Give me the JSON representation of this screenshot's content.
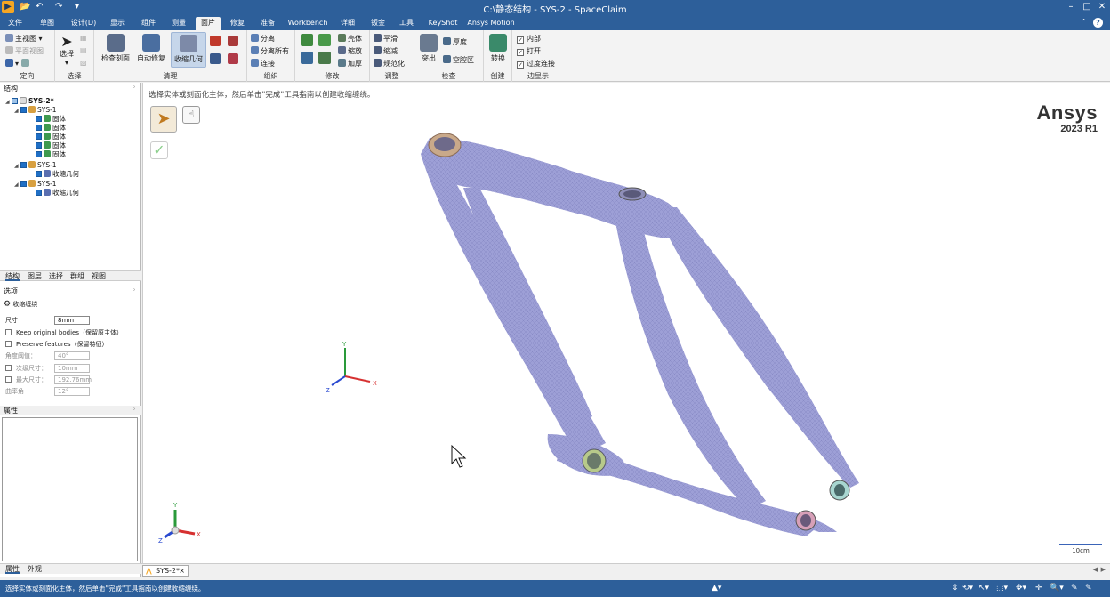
{
  "window": {
    "title": "C:\\静态结构 - SYS-2 - SpaceClaim",
    "minimize": "–",
    "maximize": "□",
    "close": "✕"
  },
  "menu": {
    "tabs": [
      "文件",
      "草图",
      "设计(D)",
      "显示",
      "组件",
      "测量",
      "面片",
      "修复",
      "准备",
      "Workbench",
      "详细",
      "钣金",
      "工具",
      "KeyShot",
      "Ansys Motion"
    ],
    "active_index": 6
  },
  "ribbon": {
    "orient": {
      "label": "定向",
      "items": [
        "主视图",
        "平面视图"
      ]
    },
    "select": {
      "label": "选择",
      "button": "选择"
    },
    "cleanup": {
      "label": "清理",
      "buttons": [
        "检查刻面",
        "自动修复",
        "收缩几何"
      ]
    },
    "organize": {
      "label": "组织",
      "items": [
        "分离",
        "分离所有",
        "连接"
      ]
    },
    "modify": {
      "label": "修改",
      "items": [
        "壳体",
        "缩放",
        "加厚"
      ]
    },
    "adjust": {
      "label": "调整",
      "items": [
        "平滑",
        "缩减",
        "规范化"
      ]
    },
    "inspect": {
      "label": "检查",
      "items": [
        "突出",
        "厚度",
        "空腔区"
      ]
    },
    "create": {
      "label": "创建",
      "button": "转换"
    },
    "edge_display": {
      "label": "边显示",
      "items": [
        "内部",
        "打开",
        "过度连接"
      ]
    }
  },
  "structure": {
    "header": "结构",
    "tree": [
      {
        "label": "SYS-2*",
        "level": 0,
        "bold": true
      },
      {
        "label": "SYS-1",
        "level": 1
      },
      {
        "label": "固体",
        "level": 2
      },
      {
        "label": "固体",
        "level": 2
      },
      {
        "label": "固体",
        "level": 2
      },
      {
        "label": "固体",
        "level": 2
      },
      {
        "label": "固体",
        "level": 2
      },
      {
        "label": "SYS-1",
        "level": 1
      },
      {
        "label": "收缩几何",
        "level": 2
      },
      {
        "label": "SYS-1",
        "level": 1
      },
      {
        "label": "收缩几何",
        "level": 2
      }
    ]
  },
  "panel_tabs": [
    "结构",
    "图层",
    "选择",
    "群组",
    "视图"
  ],
  "options": {
    "header": "选项",
    "tool_name": "收缩缠绕",
    "size_label": "尺寸",
    "size_value": "8mm",
    "keep_original": "Keep original bodies（保留原主体）",
    "preserve_features": "Preserve features（保留特征）",
    "angle_label": "角度阈值：",
    "angle_value": "40°",
    "secondary_label": "次级尺寸：",
    "secondary_value": "10mm",
    "max_label": "最大尺寸：",
    "max_value": "192.76mm",
    "curvature_label": "曲率角",
    "curvature_value": "12°"
  },
  "properties": {
    "header": "属性"
  },
  "bottom_tabs": [
    "属性",
    "外观"
  ],
  "viewport": {
    "hint": "选择实体或刻面化主体，然后单击\"完成\"工具指南以创建收缩缠绕。",
    "brand": "Ansys",
    "version": "2023 R1",
    "scale": "10cm",
    "axes": {
      "x": "X",
      "y": "Y",
      "z": "Z"
    }
  },
  "doc_tab": "SYS-2*",
  "status": {
    "text": "选择实体或刻面化主体，然后单击\"完成\"工具指南以创建收缩缠绕。"
  },
  "colors": {
    "titlebar": "#2d5f9a",
    "mesh_body": "#9d9fd6",
    "accent_checked": "#1f6fc5"
  }
}
